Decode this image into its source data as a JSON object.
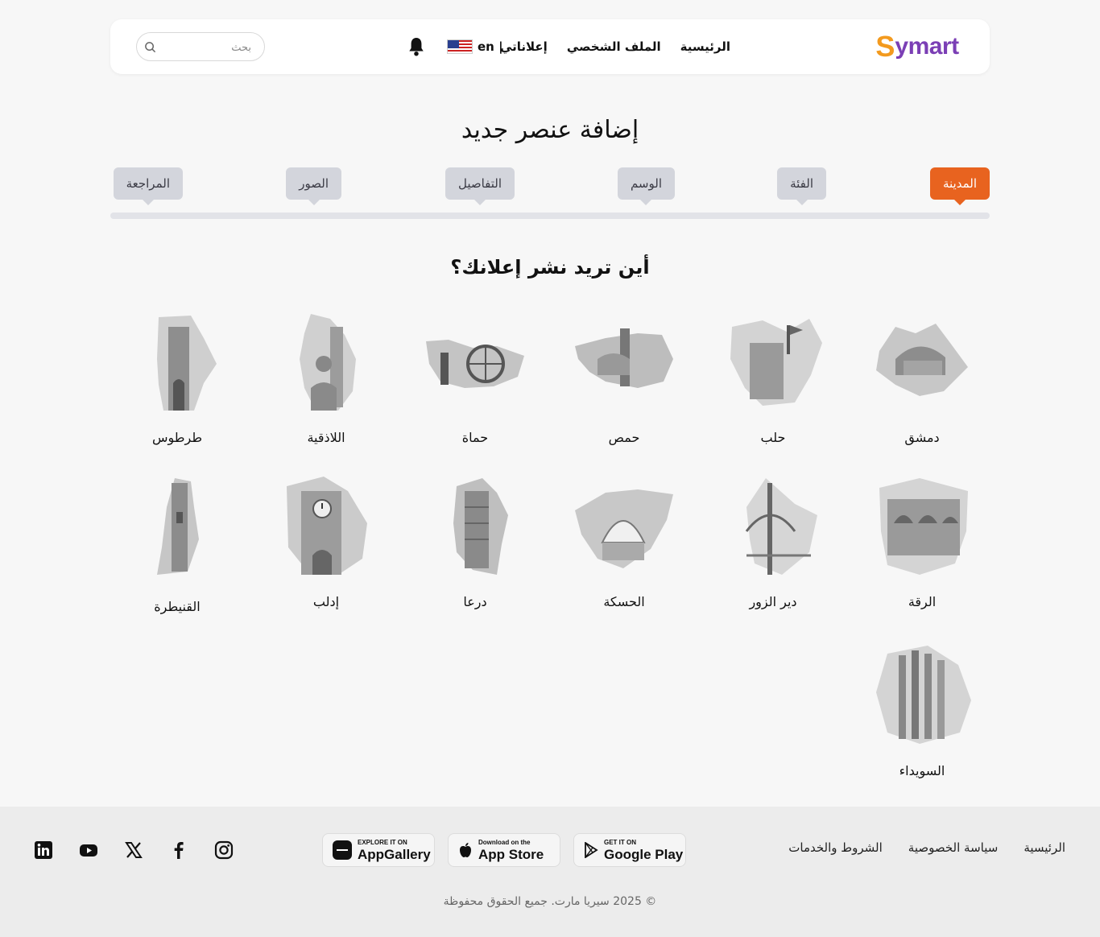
{
  "header": {
    "logo_s": "S",
    "logo_rest": "ymart",
    "nav": [
      "الرئيسية",
      "الملف الشخصي",
      "إعلاناتي"
    ],
    "language": "en |",
    "search_placeholder": "بحث"
  },
  "page_title": "إضافة عنصر جديد",
  "steps": [
    "المدينة",
    "الفئة",
    "الوسم",
    "التفاصيل",
    "الصور",
    "المراجعة"
  ],
  "active_step": "المدينة",
  "question": "أين تريد نشر إعلانك؟",
  "cities": [
    "دمشق",
    "حلب",
    "حمص",
    "حماة",
    "اللاذقية",
    "طرطوس",
    "الرقة",
    "دير الزور",
    "الحسكة",
    "درعا",
    "إدلب",
    "القنيطرة",
    "السويداء"
  ],
  "footer": {
    "links": [
      "الرئيسية",
      "سياسة الخصوصية",
      "الشروط والخدمات"
    ],
    "stores": [
      {
        "small": "GET IT ON",
        "big": "Google Play"
      },
      {
        "small": "Download on the",
        "big": "App Store"
      },
      {
        "small": "EXPLORE IT ON",
        "big": "AppGallery"
      }
    ],
    "socials": [
      "linkedin-icon",
      "youtube-icon",
      "x-icon",
      "facebook-icon",
      "instagram-icon"
    ],
    "copyright": "© 2025 سيريا مارت. جميع الحقوق محفوظة"
  },
  "colors": {
    "accent": "#e8631f",
    "step_inactive": "#d3d5dc",
    "logo_orange": "#f39a1e",
    "logo_purple": "#7b3fb5"
  }
}
